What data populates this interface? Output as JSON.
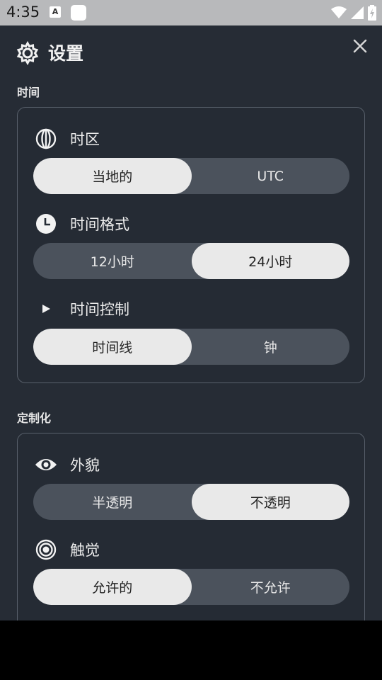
{
  "status_bar": {
    "time": "4:35",
    "a_icon_text": "A"
  },
  "header": {
    "title": "设置"
  },
  "sections": {
    "time": {
      "label": "时间",
      "timezone": {
        "label": "时区",
        "options": [
          "当地的",
          "UTC"
        ],
        "selected": 0
      },
      "time_format": {
        "label": "时间格式",
        "options": [
          "12小时",
          "24小时"
        ],
        "selected": 1
      },
      "time_control": {
        "label": "时间控制",
        "options": [
          "时间线",
          "钟"
        ],
        "selected": 0
      }
    },
    "customize": {
      "label": "定制化",
      "appearance": {
        "label": "外貌",
        "options": [
          "半透明",
          "不透明"
        ],
        "selected": 1
      },
      "haptics": {
        "label": "触觉",
        "options": [
          "允许的",
          "不允许"
        ],
        "selected": 0
      }
    }
  }
}
